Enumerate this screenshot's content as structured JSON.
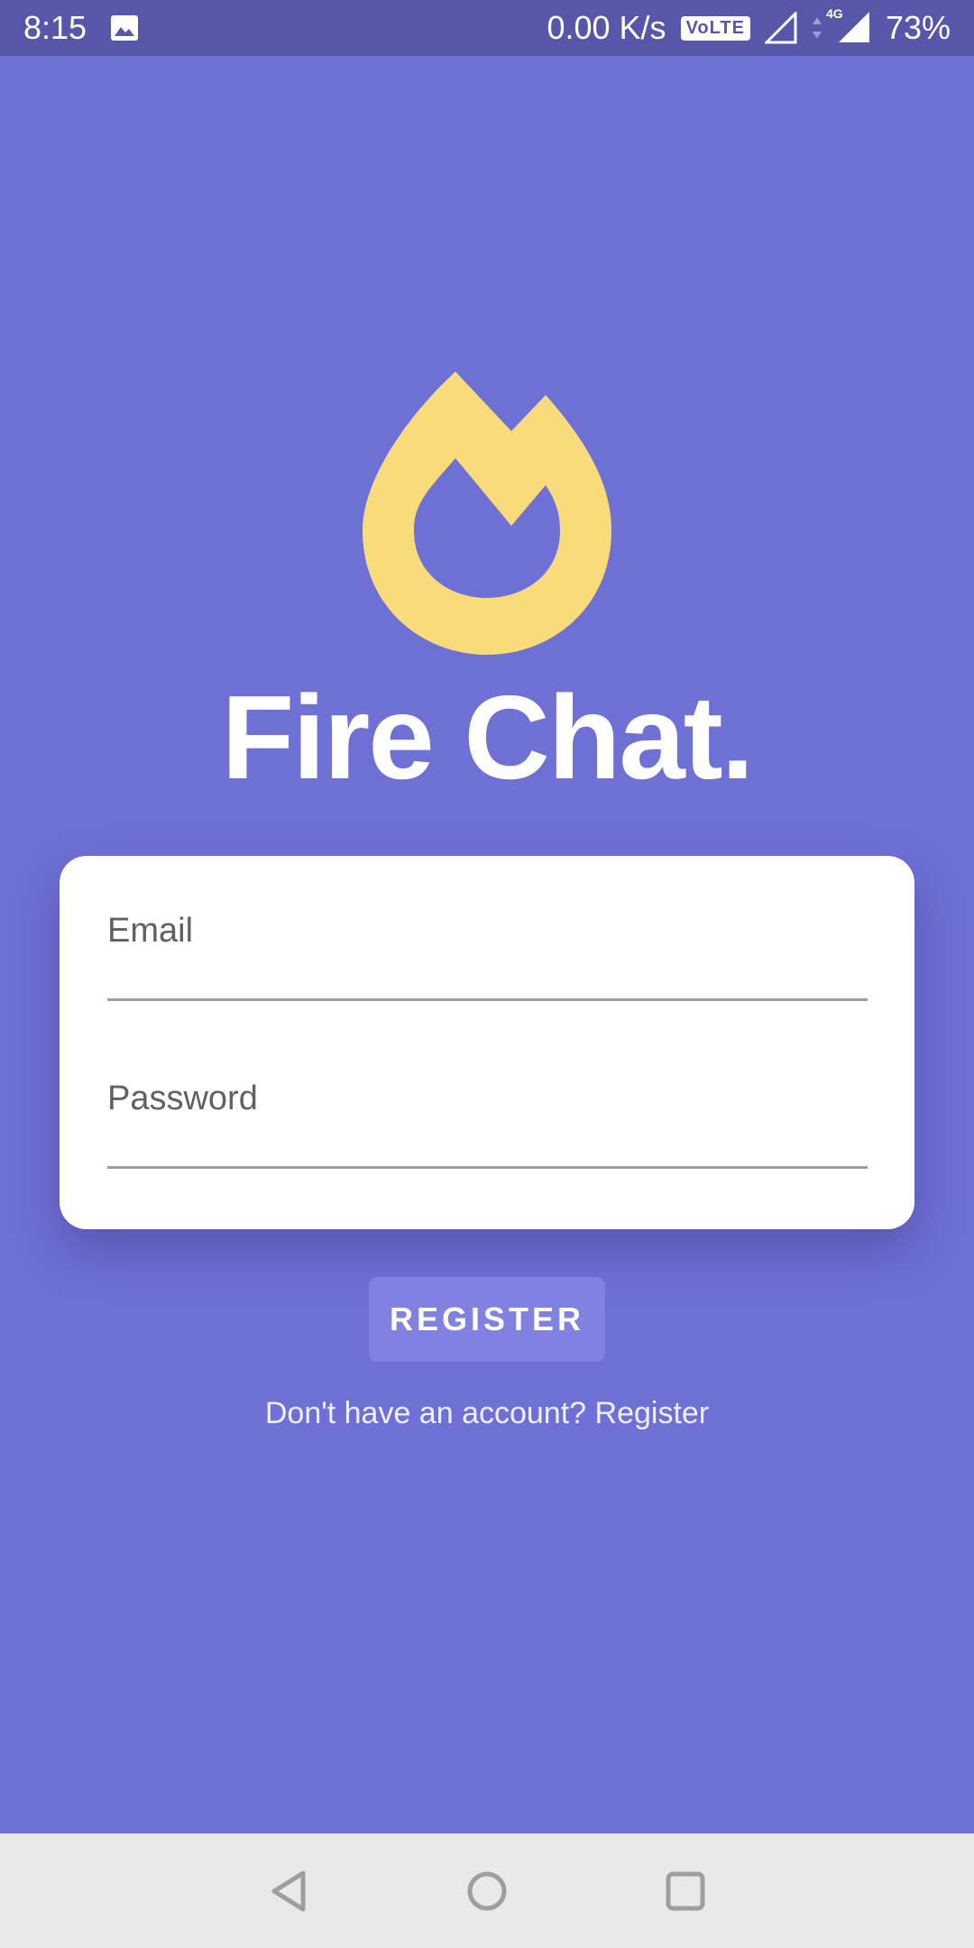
{
  "status_bar": {
    "time": "8:15",
    "network_speed": "0.00 K/s",
    "volte": "VoLTE",
    "network_type": "4G",
    "battery": "73%",
    "icons": [
      "image-notification-icon",
      "volte-icon",
      "signal-icon",
      "data-arrows-icon",
      "signal-4g-icon"
    ]
  },
  "app": {
    "title": "Fire Chat.",
    "logo_icon": "flame-logo-icon",
    "logo_color": "#f8dc7c",
    "background_color": "#6f70d6"
  },
  "form": {
    "email_label": "Email",
    "email_value": "",
    "password_label": "Password",
    "password_value": ""
  },
  "register_button": {
    "label": "REGISTER"
  },
  "signup_prompt": {
    "text": "Don't have an account? ",
    "link": "Register"
  },
  "nav_bar": {
    "icons": [
      "back-icon",
      "home-icon",
      "recents-icon"
    ]
  }
}
